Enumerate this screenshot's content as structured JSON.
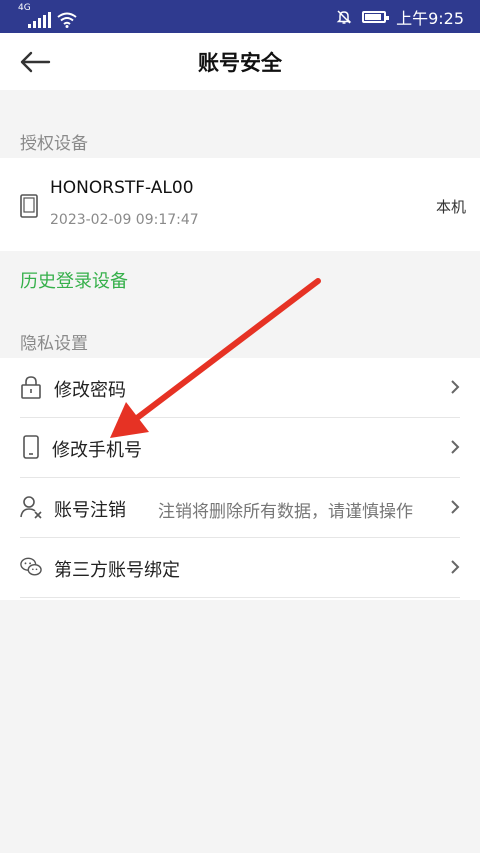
{
  "status_bar": {
    "network": "4G",
    "time": "上午9:25"
  },
  "header": {
    "title": "账号安全",
    "back_icon": "arrow-left-icon"
  },
  "authorized_devices": {
    "section_label": "授权设备",
    "device": {
      "name": "HONORSTF-AL00",
      "timestamp": "2023-02-09 09:17:47",
      "tag": "本机"
    }
  },
  "history_link": "历史登录设备",
  "privacy": {
    "section_label": "隐私设置",
    "items": [
      {
        "label": "修改密码",
        "icon": "lock-icon"
      },
      {
        "label": "修改手机号",
        "icon": "phone-icon"
      },
      {
        "label": "账号注销",
        "icon": "user-remove-icon",
        "description": "注销将删除所有数据，请谨慎操作"
      },
      {
        "label": "第三方账号绑定",
        "icon": "wechat-icon"
      }
    ]
  },
  "colors": {
    "status_bar": "#2f3a8f",
    "link_green": "#36b04b",
    "annotation_arrow": "#e63224"
  }
}
